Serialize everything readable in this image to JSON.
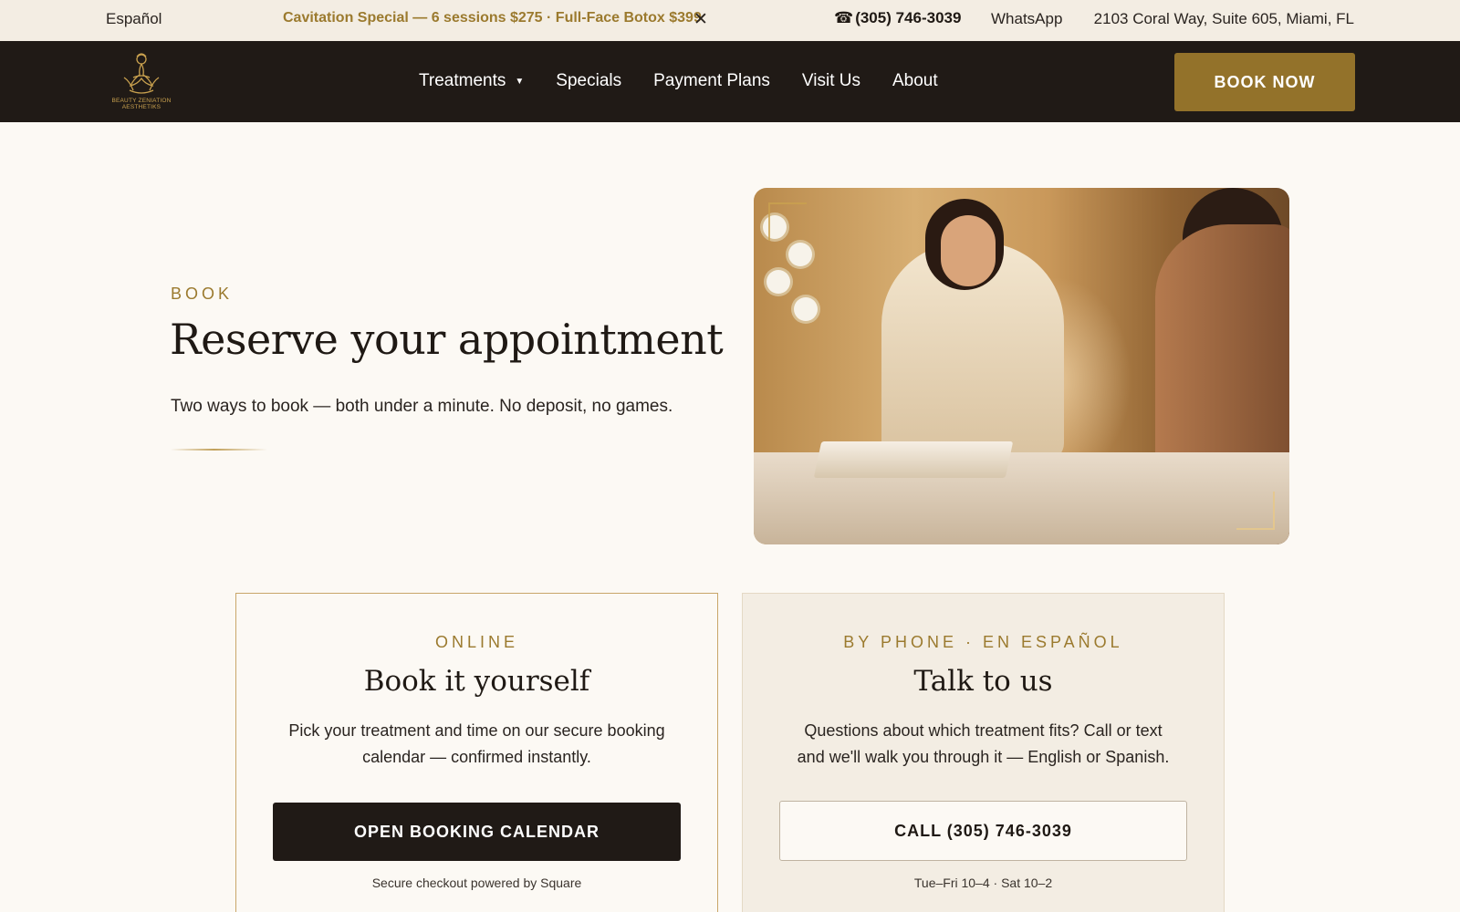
{
  "topbar": {
    "language": "Español",
    "promo": "Cavitation Special — 6 sessions $275 · Full-Face Botox $399",
    "close_glyph": "✕",
    "phone_icon": "☎",
    "phone": "(305) 746-3039",
    "whatsapp": "WhatsApp",
    "address": "2103 Coral Way, Suite 605, Miami, FL"
  },
  "nav": {
    "logo_text": "BEAUTY ZENIATION AESTHETIKS",
    "items": [
      {
        "label": "Treatments",
        "has_dropdown": true
      },
      {
        "label": "Specials"
      },
      {
        "label": "Payment Plans"
      },
      {
        "label": "Visit Us"
      },
      {
        "label": "About"
      }
    ],
    "cta": "BOOK NOW"
  },
  "hero": {
    "eyebrow": "BOOK",
    "title": "Reserve your appointment",
    "subtitle": "Two ways to book — both under a minute. No deposit, no games."
  },
  "cards": {
    "online": {
      "eyebrow": "ONLINE",
      "title": "Book it yourself",
      "description": "Pick your treatment and time on our secure booking calendar — confirmed instantly.",
      "button": "OPEN BOOKING CALENDAR",
      "note": "Secure checkout powered by Square"
    },
    "phone": {
      "eyebrow": "BY PHONE · EN ESPAÑOL",
      "title": "Talk to us",
      "description": "Questions about which treatment fits? Call or text and we'll walk you through it — English or Spanish.",
      "button": "CALL (305) 746-3039",
      "note": "Tue–Fri 10–4 · Sat 10–2"
    }
  },
  "colors": {
    "gold": "#9b7a2e",
    "cta_gold": "#93722a",
    "dark": "#201a16",
    "cream": "#fcf9f4",
    "topbar_bg": "#f3ede3"
  }
}
